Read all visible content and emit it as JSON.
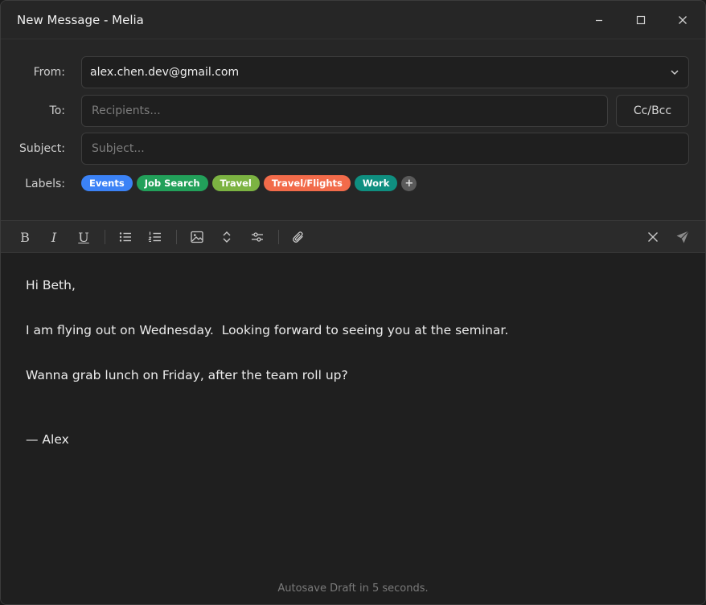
{
  "window": {
    "title": "New Message - Melia"
  },
  "header": {
    "from_label": "From:",
    "from_value": "alex.chen.dev@gmail.com",
    "to_label": "To:",
    "to_placeholder": "Recipients...",
    "ccbcc_label": "Cc/Bcc",
    "subject_label": "Subject:",
    "subject_placeholder": "Subject...",
    "labels_label": "Labels:",
    "labels": [
      {
        "name": "Events",
        "color": "#3b82f6"
      },
      {
        "name": "Job Search",
        "color": "#22a05a"
      },
      {
        "name": "Travel",
        "color": "#7cb342"
      },
      {
        "name": "Travel/Flights",
        "color": "#f26b4a"
      },
      {
        "name": "Work",
        "color": "#0f8f80"
      }
    ],
    "add_label_glyph": "+"
  },
  "toolbar": {
    "bold": "B",
    "italic": "I",
    "underline": "U"
  },
  "body": {
    "greeting": "Hi Beth,",
    "line1": "I am flying out on Wednesday.  Looking forward to seeing you at the seminar.",
    "line2": "Wanna grab lunch on Friday, after the team roll up?",
    "signature": "— Alex"
  },
  "footer": {
    "autosave": "Autosave Draft in 5 seconds."
  },
  "colors": {
    "background": "#1f1f1f",
    "header_bg": "#262626",
    "toolbar_bg": "#2b2b2b"
  }
}
